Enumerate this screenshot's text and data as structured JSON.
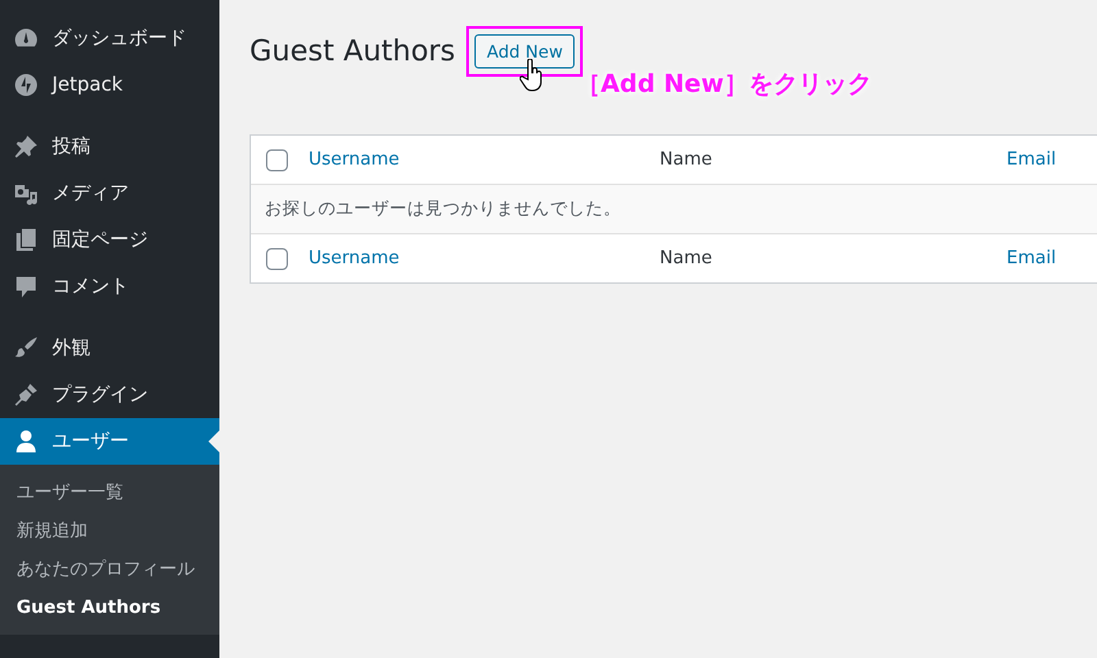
{
  "sidebar": {
    "groups": [
      [
        {
          "label": "ダッシュボード",
          "selected": false
        },
        {
          "label": "Jetpack",
          "selected": false
        }
      ],
      [
        {
          "label": "投稿",
          "selected": false
        },
        {
          "label": "メディア",
          "selected": false
        },
        {
          "label": "固定ページ",
          "selected": false
        },
        {
          "label": "コメント",
          "selected": false
        }
      ],
      [
        {
          "label": "外観",
          "selected": false
        },
        {
          "label": "プラグイン",
          "selected": false
        },
        {
          "label": "ユーザー",
          "selected": true,
          "submenu": [
            {
              "label": "ユーザー一覧",
              "selected": false
            },
            {
              "label": "新規追加",
              "selected": false
            },
            {
              "label": "あなたのプロフィール",
              "selected": false
            },
            {
              "label": "Guest Authors",
              "selected": true
            }
          ]
        }
      ]
    ]
  },
  "page": {
    "title": "Guest Authors",
    "add_button": "Add New"
  },
  "annotation": {
    "text": "［Add New］をクリック"
  },
  "table": {
    "header": [
      {
        "label": "Username",
        "sortable": true
      },
      {
        "label": "Name",
        "sortable": false
      },
      {
        "label": "Email",
        "sortable": true
      }
    ],
    "select_all_checked": false,
    "empty_message": "お探しのユーザーは見つかりませんでした。",
    "footer": [
      {
        "label": "Username",
        "sortable": true
      },
      {
        "label": "Name",
        "sortable": false
      },
      {
        "label": "Email",
        "sortable": true
      }
    ],
    "footer_select_all_checked": false
  }
}
